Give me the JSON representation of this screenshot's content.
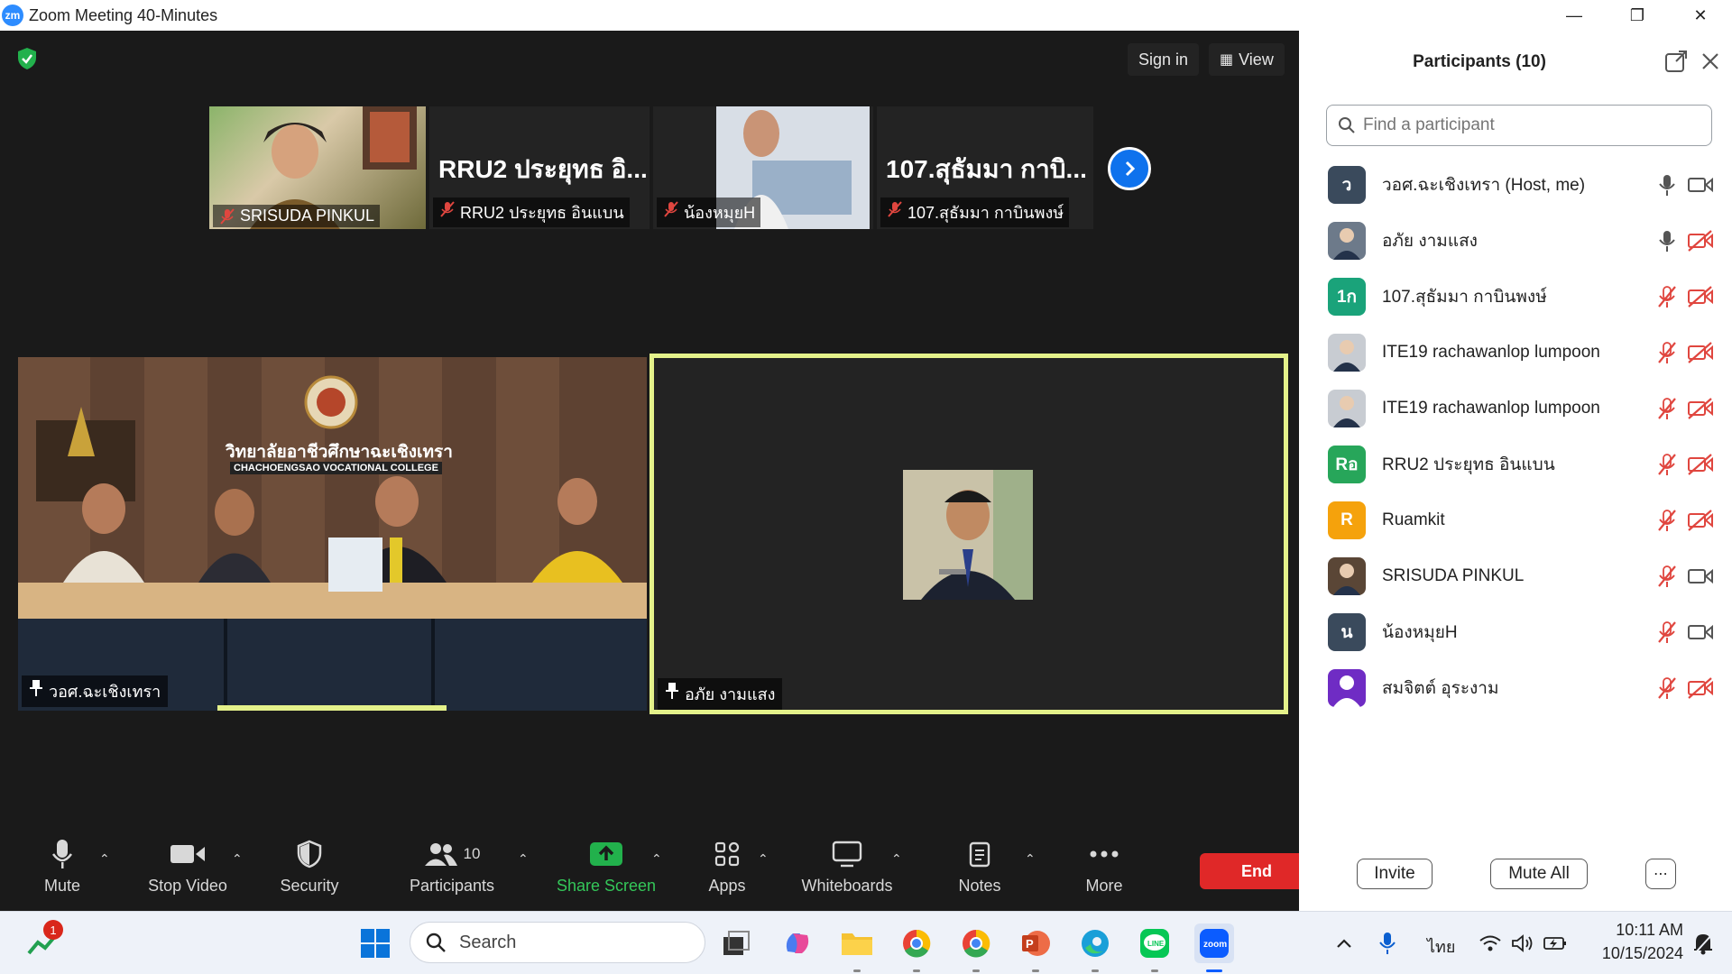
{
  "window": {
    "title": "Zoom Meeting 40-Minutes",
    "logo_text": "zm"
  },
  "meeting": {
    "sign_in_label": "Sign in",
    "view_label": "View",
    "thumbnails": [
      {
        "name": "SRISUDA PINKUL",
        "big_name": ""
      },
      {
        "name": "RRU2 ประยุทธ อินแบน",
        "big_name": "RRU2 ประยุทธ อิ..."
      },
      {
        "name": "น้องหมุยH",
        "big_name": ""
      },
      {
        "name": "107.สุธัมมา กาบินพงษ์",
        "big_name": "107.สุธัมมา กาบิ..."
      }
    ],
    "main_tiles": [
      {
        "name": "วอศ.ฉะเชิงเทรา",
        "sign_thai": "วิทยาลัยอาชีวศึกษาฉะเชิงเทรา",
        "sign_en": "CHACHOENGSAO VOCATIONAL COLLEGE"
      },
      {
        "name": "อภัย งามแสง"
      }
    ]
  },
  "toolbar": {
    "mute": "Mute",
    "stop_video": "Stop Video",
    "security": "Security",
    "participants": "Participants",
    "participants_count": "10",
    "share_screen": "Share Screen",
    "apps": "Apps",
    "whiteboards": "Whiteboards",
    "notes": "Notes",
    "more": "More",
    "end": "End"
  },
  "panel": {
    "title": "Participants (10)",
    "search_placeholder": "Find a participant",
    "invite": "Invite",
    "mute_all": "Mute All",
    "participants": [
      {
        "name": "วอศ.ฉะเชิงเทรา (Host, me)",
        "initials": "ว",
        "color": "#3a4a5c",
        "mic": "on",
        "video": "on"
      },
      {
        "name": "อภัย งามแสง",
        "initials": "",
        "color": "#6d7a8a",
        "mic": "on",
        "video": "off"
      },
      {
        "name": "107.สุธัมมา กาบินพงษ์",
        "initials": "1ก",
        "color": "#1aa37a",
        "mic": "off",
        "video": "off"
      },
      {
        "name": "ITE19 rachawanlop lumpoon",
        "initials": "",
        "color": "#c8ccd2",
        "mic": "off",
        "video": "off"
      },
      {
        "name": "ITE19 rachawanlop lumpoon",
        "initials": "",
        "color": "#c8ccd2",
        "mic": "off",
        "video": "off"
      },
      {
        "name": "RRU2 ประยุทธ อินแบน",
        "initials": "Rอ",
        "color": "#27a65a",
        "mic": "off",
        "video": "off"
      },
      {
        "name": "Ruamkit",
        "initials": "R",
        "color": "#f5a20c",
        "mic": "off",
        "video": "off"
      },
      {
        "name": "SRISUDA PINKUL",
        "initials": "",
        "color": "#5a4636",
        "mic": "off",
        "video": "on"
      },
      {
        "name": "น้องหมุยH",
        "initials": "น",
        "color": "#3a4a5c",
        "mic": "off",
        "video": "on"
      },
      {
        "name": "สมจิตต์ อุระงาม",
        "initials": "",
        "color": "#6f2cc4",
        "mic": "off",
        "video": "off"
      }
    ]
  },
  "taskbar": {
    "search_placeholder": "Search",
    "notification_badge": "1",
    "language": "ไทย",
    "time": "10:11 AM",
    "date": "10/15/2024"
  },
  "colors": {
    "accent": "#0e72ed",
    "end": "#e02828",
    "active_speaker": "#e4f18a",
    "muted": "#e0463f"
  }
}
